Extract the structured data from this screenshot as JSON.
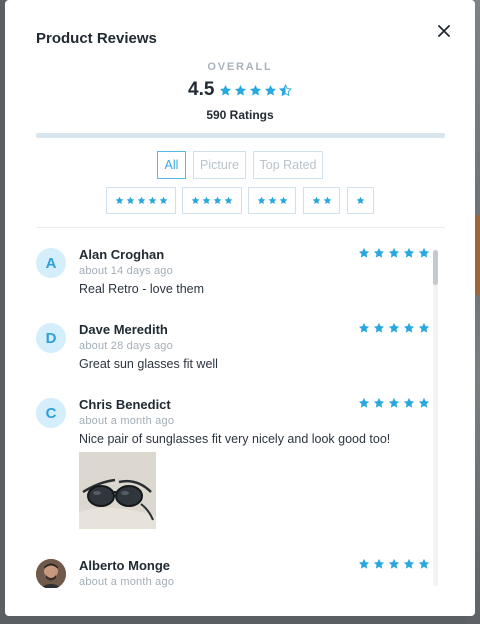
{
  "modal": {
    "title": "Product Reviews",
    "close_icon": "close-icon"
  },
  "summary": {
    "overall_label": "OVERALL",
    "average_rating": "4.5",
    "star_level": 4.5,
    "ratings_count": "590 Ratings"
  },
  "filters": {
    "tabs": [
      {
        "label": "All",
        "active": true
      },
      {
        "label": "Picture",
        "active": false
      },
      {
        "label": "Top Rated",
        "active": false
      }
    ],
    "star_filters": [
      5,
      4,
      3,
      2,
      1
    ]
  },
  "reviews": [
    {
      "initial": "A",
      "name": "Alan Croghan",
      "date": "about 14 days ago",
      "text": "Real Retro - love them",
      "stars": 5,
      "has_photo": false
    },
    {
      "initial": "D",
      "name": "Dave Meredith",
      "date": "about 28 days ago",
      "text": "Great sun glasses fit well",
      "stars": 5,
      "has_photo": false
    },
    {
      "initial": "C",
      "name": "Chris Benedict",
      "date": "about a month ago",
      "text": "Nice pair of sunglasses fit very nicely and look good too!",
      "stars": 5,
      "has_photo": true
    },
    {
      "initial": "",
      "name": "Alberto Monge",
      "date": "about a month ago",
      "text": "",
      "stars": 5,
      "has_photo": false,
      "avatar_photo": true
    }
  ],
  "colors": {
    "accent": "#3aa9e0",
    "star": "#29a8e0",
    "text": "#222a33",
    "muted": "#a3aeb7"
  }
}
